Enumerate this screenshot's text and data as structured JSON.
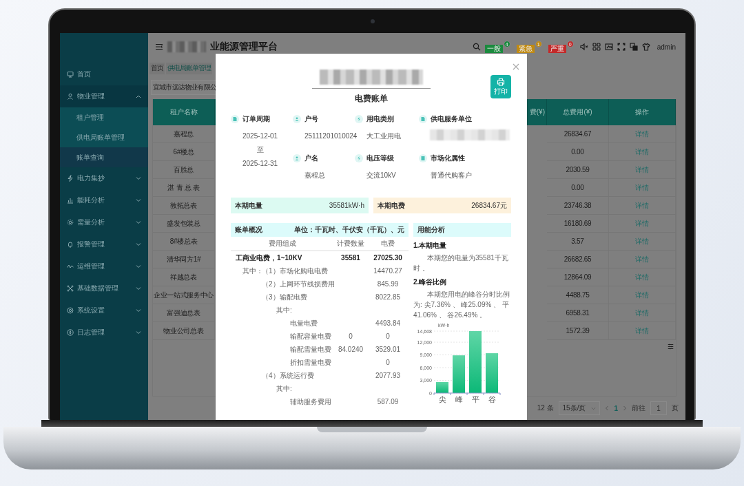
{
  "sidebar": {
    "items": [
      {
        "kind": "link",
        "label": "首页"
      },
      {
        "kind": "group",
        "label": "物业管理",
        "expanded": true,
        "children": [
          {
            "label": "租户管理",
            "selected": false
          },
          {
            "label": "供电局账单管理",
            "selected": false
          },
          {
            "label": "账单查询",
            "selected": true
          }
        ]
      },
      {
        "kind": "group",
        "label": "电力集抄",
        "expanded": false
      },
      {
        "kind": "group",
        "label": "能耗分析",
        "expanded": false
      },
      {
        "kind": "group",
        "label": "需量分析",
        "expanded": false
      },
      {
        "kind": "group",
        "label": "报警管理",
        "expanded": false
      },
      {
        "kind": "group",
        "label": "运维管理",
        "expanded": false
      },
      {
        "kind": "group",
        "label": "基础数据管理",
        "expanded": false
      },
      {
        "kind": "group",
        "label": "系统设置",
        "expanded": false
      },
      {
        "kind": "group",
        "label": "日志管理",
        "expanded": false
      }
    ]
  },
  "header": {
    "title": "业能源管理平台",
    "alerts": [
      {
        "label": "一般",
        "count": "4",
        "color": "#1b8a3e"
      },
      {
        "label": "紧急",
        "count": "1",
        "color": "#c08a12"
      },
      {
        "label": "严重",
        "count": "0",
        "color": "#c22a2a"
      }
    ],
    "user": "admin"
  },
  "breadcrumbs": [
    {
      "label": "首页",
      "selected": false
    },
    {
      "label": "供电局账单管理",
      "selected": true
    }
  ],
  "filter": {
    "value": "宜城市远达物业有限公"
  },
  "table": {
    "columns": [
      {
        "label": "租户名称"
      },
      {
        "label": "费(¥)"
      },
      {
        "label": "总费用(¥)"
      },
      {
        "label": "操作"
      }
    ],
    "rows": [
      {
        "tenant": "嘉程总",
        "total": "26834.67",
        "action": "详情"
      },
      {
        "tenant": "6#楼总",
        "total": "0.00",
        "action": "详情"
      },
      {
        "tenant": "百胜总",
        "total": "2030.59",
        "action": "详情"
      },
      {
        "tenant": "湛 青 总 表",
        "total": "0.00",
        "action": "详情"
      },
      {
        "tenant": "敦拓总表",
        "total": "23746.38",
        "action": "详情"
      },
      {
        "tenant": "盛发包装总",
        "total": "16180.69",
        "action": "详情"
      },
      {
        "tenant": "8#楼总表",
        "total": "3.57",
        "action": "详情"
      },
      {
        "tenant": "清华同方1#",
        "total": "26682.65",
        "action": "详情"
      },
      {
        "tenant": "祥越总表",
        "total": "12864.09",
        "action": "详情"
      },
      {
        "tenant": "企业一站式服务中心",
        "total": "4488.75",
        "action": "详情"
      },
      {
        "tenant": "富强迪总表",
        "total": "6958.31",
        "action": "详情"
      },
      {
        "tenant": "物业公司总表",
        "total": "1572.39",
        "action": "详情"
      }
    ]
  },
  "pagination": {
    "total": "12 条",
    "page_size": "15条/页",
    "current": "1",
    "goto_label": "前往",
    "goto_value": "1",
    "page_unit": "页"
  },
  "dialog": {
    "subtitle": "电费账单",
    "print_label": "打印",
    "fields": [
      {
        "kind": "text",
        "label": "订单周期",
        "values": [
          "2025-12-01",
          "至",
          "2025-12-31"
        ]
      },
      {
        "kind": "text",
        "label": "户号",
        "values": [
          "25111201010024"
        ]
      },
      {
        "kind": "text",
        "label": "用电类别",
        "values": [
          "大工业用电"
        ]
      },
      {
        "kind": "redacted",
        "label": "供电服务单位"
      },
      {
        "kind": "text",
        "label": "户名",
        "values": [
          "嘉程总"
        ]
      },
      {
        "kind": "text",
        "label": "电压等级",
        "values": [
          "交流10kV"
        ]
      },
      {
        "kind": "text",
        "label": "市场化属性",
        "values": [
          "普通代购客户"
        ]
      }
    ],
    "summary": [
      {
        "label": "本期电量",
        "value": "35581kW·h",
        "color": "#dcfaf2"
      },
      {
        "label": "本期电费",
        "value": "26834.67元",
        "color": "#fdf1dc"
      }
    ],
    "bill": {
      "title": "账单概况",
      "unit": "单位：千瓦时、千伏安（千瓦）、元",
      "columns": [
        "费用组成",
        "计费数量",
        "电费"
      ],
      "rows": [
        {
          "label": "工商业电费，1~10KV",
          "quantity": "35581",
          "fee": "27025.30",
          "children": [
            {
              "prefix": "其中：",
              "label": "（1）市场化购电电费",
              "fee": "14470.27"
            },
            {
              "label": "（2）上网环节线损费用",
              "fee": "845.99"
            },
            {
              "label": "（3）输配电费",
              "fee": "8022.85",
              "children": [
                {
                  "label": "其中:",
                  "children": [
                    {
                      "label": "电量电费",
                      "fee": "4493.84"
                    },
                    {
                      "label": "输配容量电费",
                      "quantity": "0",
                      "fee": "0"
                    },
                    {
                      "label": "输配需量电费",
                      "quantity": "84.0240",
                      "fee": "3529.01"
                    },
                    {
                      "label": "折扣需量电费",
                      "fee": "0"
                    }
                  ]
                }
              ]
            },
            {
              "label": "（4）系统运行费",
              "fee": "2077.93",
              "children": [
                {
                  "label": "其中:",
                  "children": [
                    {
                      "label": "辅助服务费用",
                      "fee": "587.09"
                    }
                  ]
                }
              ]
            }
          ]
        }
      ]
    },
    "analysis": {
      "title": "用能分析",
      "sections": [
        {
          "heading": "1.本期电量",
          "text": "本期您的电量为35581千瓦时 。"
        },
        {
          "heading": "2.峰谷比例",
          "text": "本期您用电的峰谷分时比例为: 尖7.36% 、 峰25.09% 、 平41.06% 、 谷26.49% 。"
        }
      ],
      "chart_data": {
        "type": "bar",
        "ylabel": "kW·h",
        "categories": [
          "尖",
          "峰",
          "平",
          "谷"
        ],
        "values": [
          2600,
          8900,
          14608,
          9400
        ],
        "ylim": [
          0,
          14608
        ],
        "grid": true,
        "yticks": [
          0,
          {
            "value": 3000,
            "label": "3,000"
          },
          {
            "value": 6000,
            "label": "6,000"
          },
          {
            "value": 9000,
            "label": "9,000"
          },
          {
            "value": 12000,
            "label": "12,000"
          },
          {
            "value": 14608,
            "label": "14,608"
          }
        ]
      }
    }
  }
}
